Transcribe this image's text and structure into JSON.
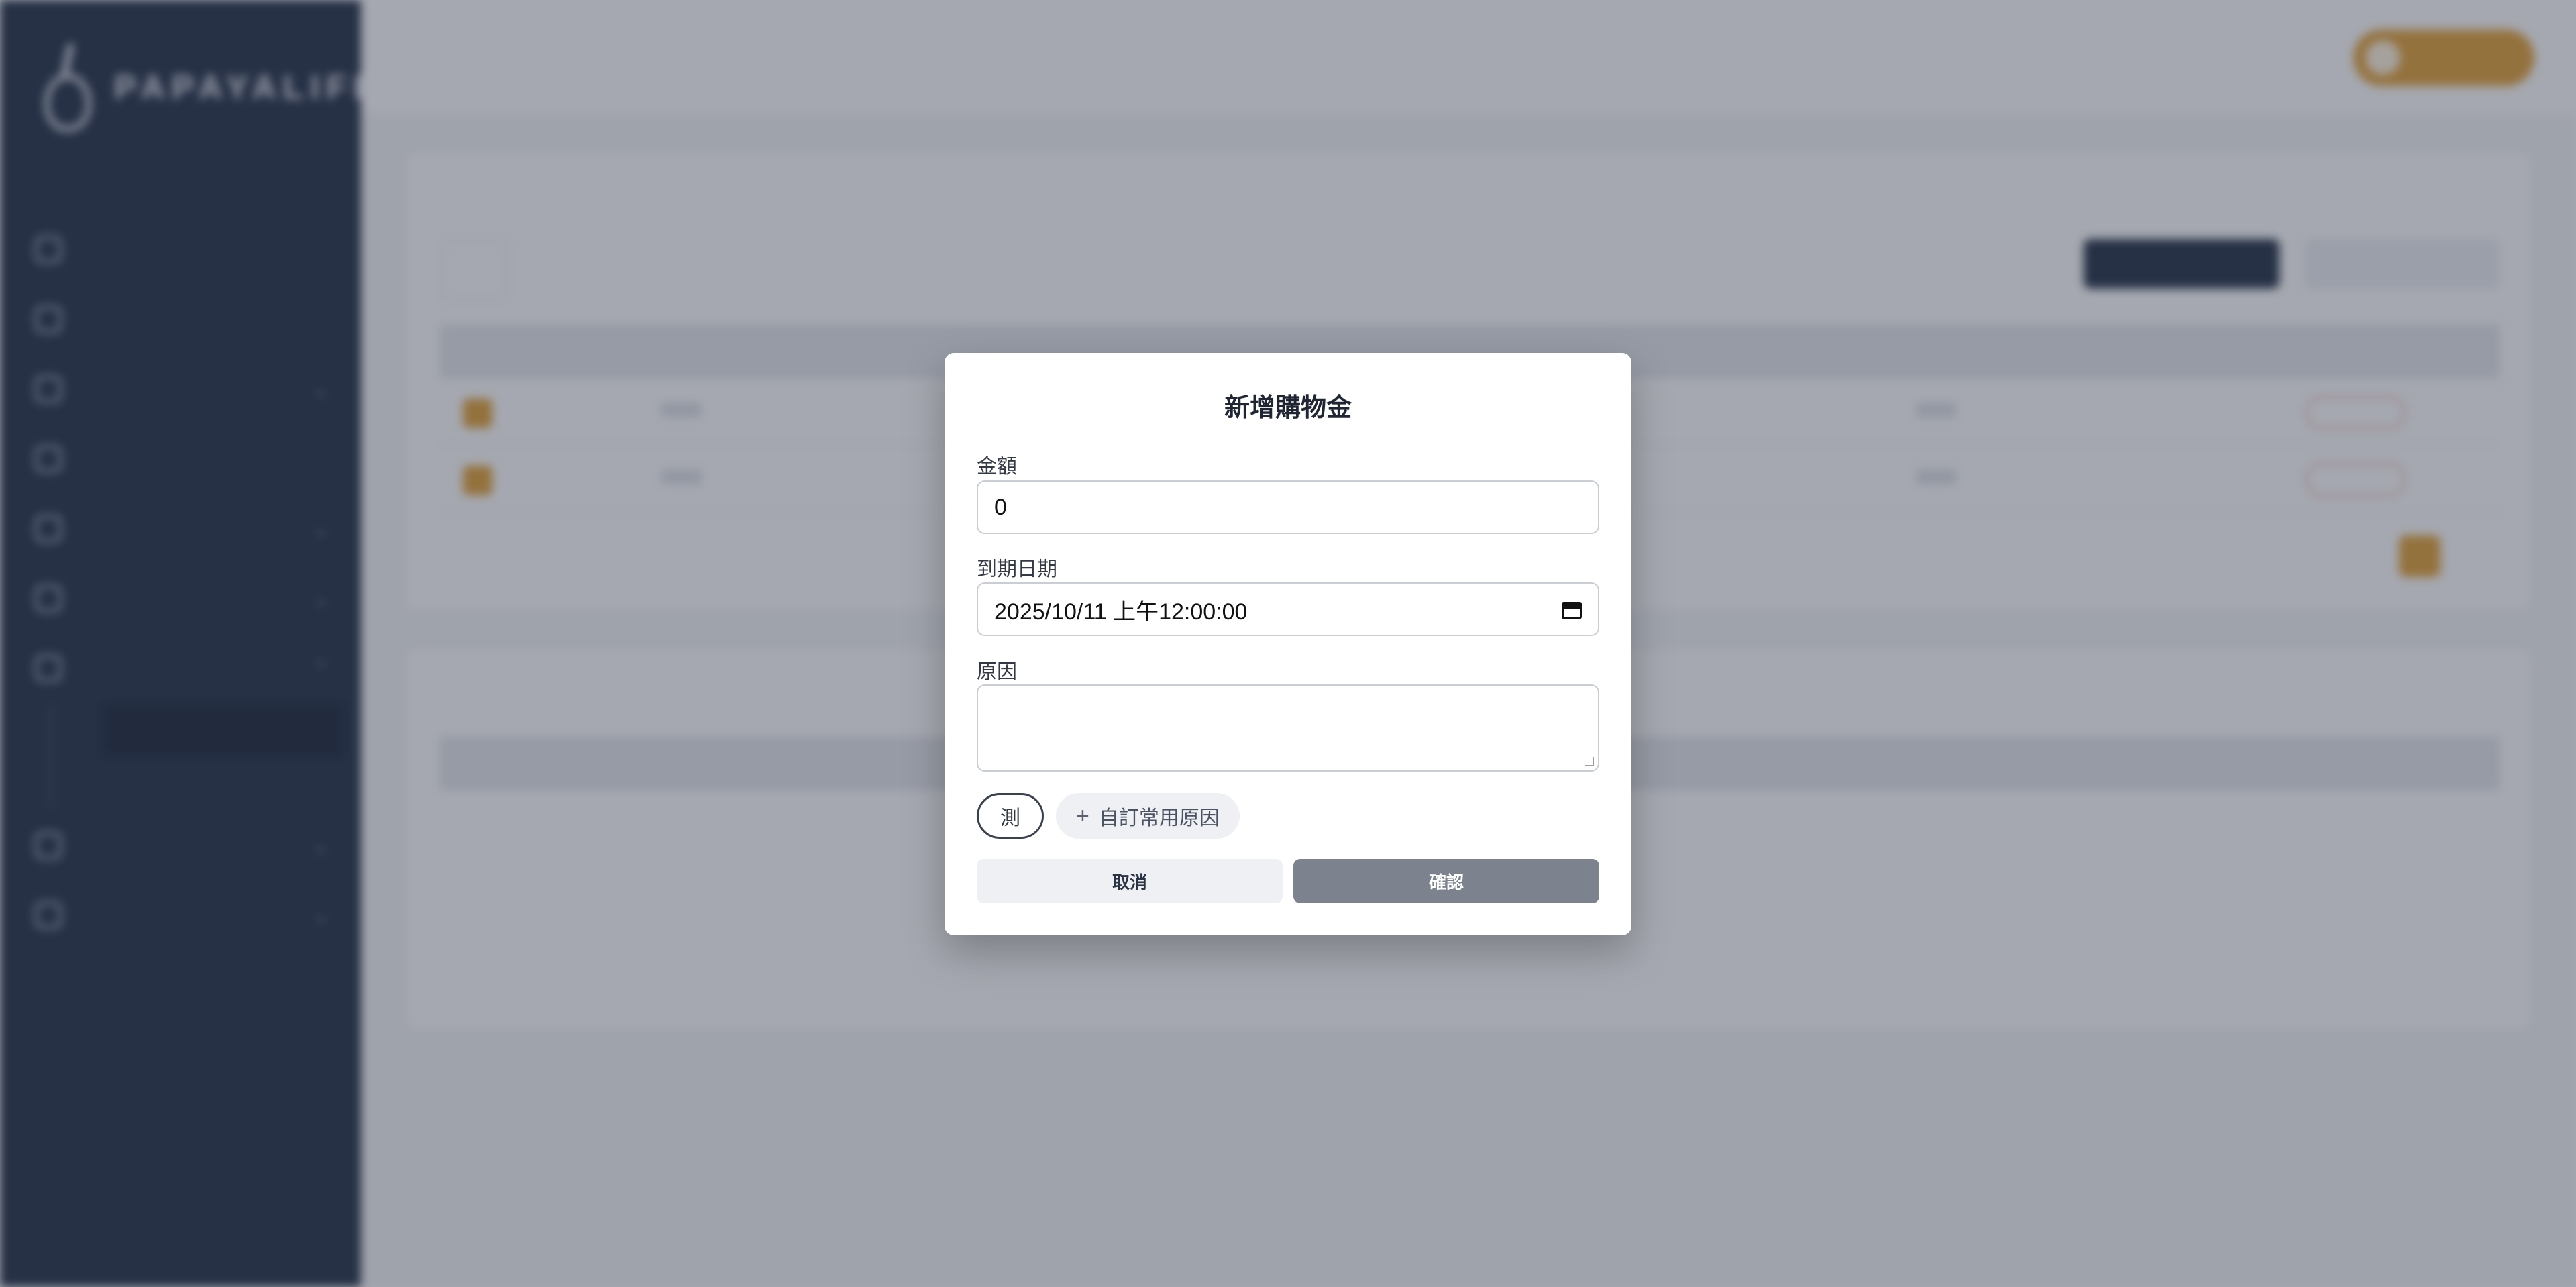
{
  "sidebar": {
    "brand": "PAPAYALIFE",
    "brand_sub": "",
    "nav": [
      {
        "label": "",
        "icon": "house-icon",
        "chevron": ""
      },
      {
        "label": "",
        "icon": "chart-icon",
        "chevron": ""
      },
      {
        "label": "",
        "icon": "gear-icon",
        "chevron": "⌄"
      },
      {
        "label": "",
        "icon": "grid-icon",
        "chevron": ""
      },
      {
        "label": "",
        "icon": "box-icon",
        "chevron": "⌄"
      },
      {
        "label": "",
        "icon": "cart-icon",
        "chevron": "⌄"
      },
      {
        "label": "",
        "icon": "users-icon",
        "chevron": "⌃"
      }
    ],
    "sub_items": [
      "",
      ""
    ],
    "nav_after": [
      {
        "label": "",
        "icon": "tag-icon",
        "chevron": "⌄"
      },
      {
        "label": "",
        "icon": "store-icon",
        "chevron": "⌄"
      }
    ]
  },
  "header": {
    "title": "",
    "breadcrumb": [
      "",
      "",
      ""
    ],
    "user": ""
  },
  "modal": {
    "title": "新增購物金",
    "amount_label": "金額",
    "amount_value": "0",
    "date_label": "到期日期",
    "date_value": "2025/10/11 上午12:00:00",
    "reason_label": "原因",
    "reason_value": "",
    "chips": [
      "測"
    ],
    "add_reason_label": "自訂常用原因",
    "cancel_label": "取消",
    "confirm_label": "確認"
  },
  "colors": {
    "accent": "#e2a23a",
    "sidebar": "#253248",
    "confirm_disabled": "#7c838e"
  }
}
